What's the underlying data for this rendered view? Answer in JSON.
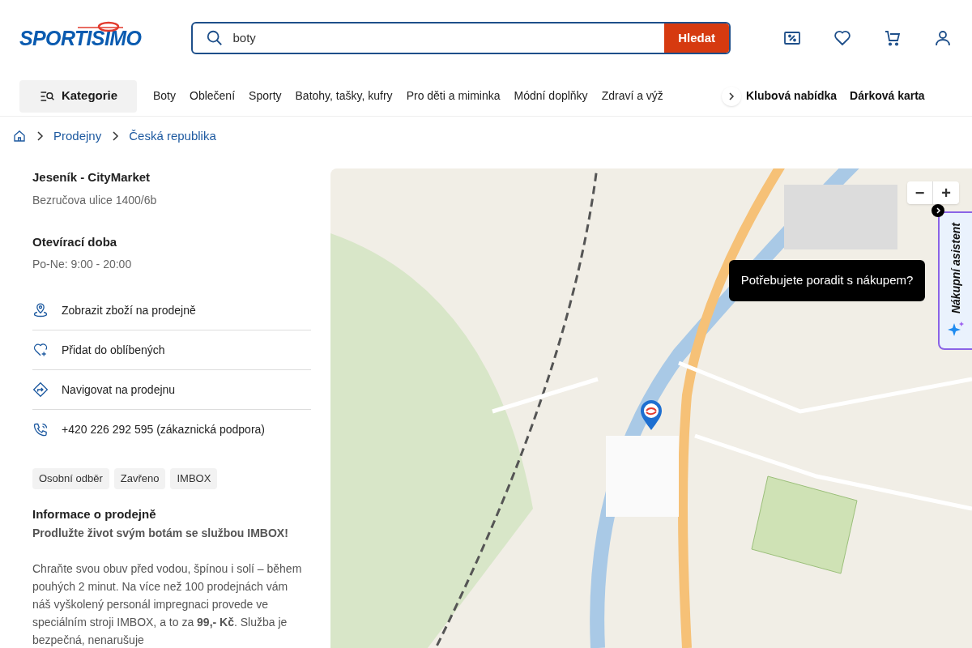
{
  "header": {
    "logo": "SPORTISIMO",
    "search": {
      "value": "boty",
      "button": "Hledat"
    }
  },
  "nav": {
    "category_button": "Kategorie",
    "items": [
      "Boty",
      "Oblečení",
      "Sporty",
      "Batohy, tašky, kufry",
      "Pro děti a miminka",
      "Módní doplňky",
      "Zdraví a výž"
    ],
    "extra": [
      "Klubová nabídka",
      "Dárková karta"
    ]
  },
  "breadcrumbs": [
    "Prodejny",
    "Česká republika"
  ],
  "store": {
    "name": "Jeseník - CityMarket",
    "address": "Bezručova ulice 1400/6b",
    "hours_title": "Otevírací doba",
    "hours": "Po-Ne: 9:00 - 20:00",
    "actions": [
      {
        "kind": "pin",
        "label": "Zobrazit zboží na prodejně"
      },
      {
        "kind": "heart",
        "label": "Přidat do oblíbených"
      },
      {
        "kind": "navigate",
        "label": "Navigovat na prodejnu"
      },
      {
        "kind": "phone",
        "label": "+420 226 292 595 (zákaznická podpora)"
      }
    ],
    "tags": [
      "Osobní odběr",
      "Zavřeno",
      "IMBOX"
    ],
    "info_title": "Informace o prodejně",
    "info_headline": "Prodlužte život svým botám se službou IMBOX!",
    "info_text": "Chraňte svou obuv před vodou, špínou i solí – během pouhých 2 minut. Na více než 100 prodejnách vám náš vyškolený personál impregnaci provede ve speciálním stroji IMBOX, a to za **99,- Kč**. Služba je bezpečná, nenarušuje"
  },
  "map": {
    "zoom_out": "−",
    "zoom_in": "+",
    "tooltip": "Potřebujete poradit s nákupem?",
    "assistant": "Nákupní asistent"
  }
}
